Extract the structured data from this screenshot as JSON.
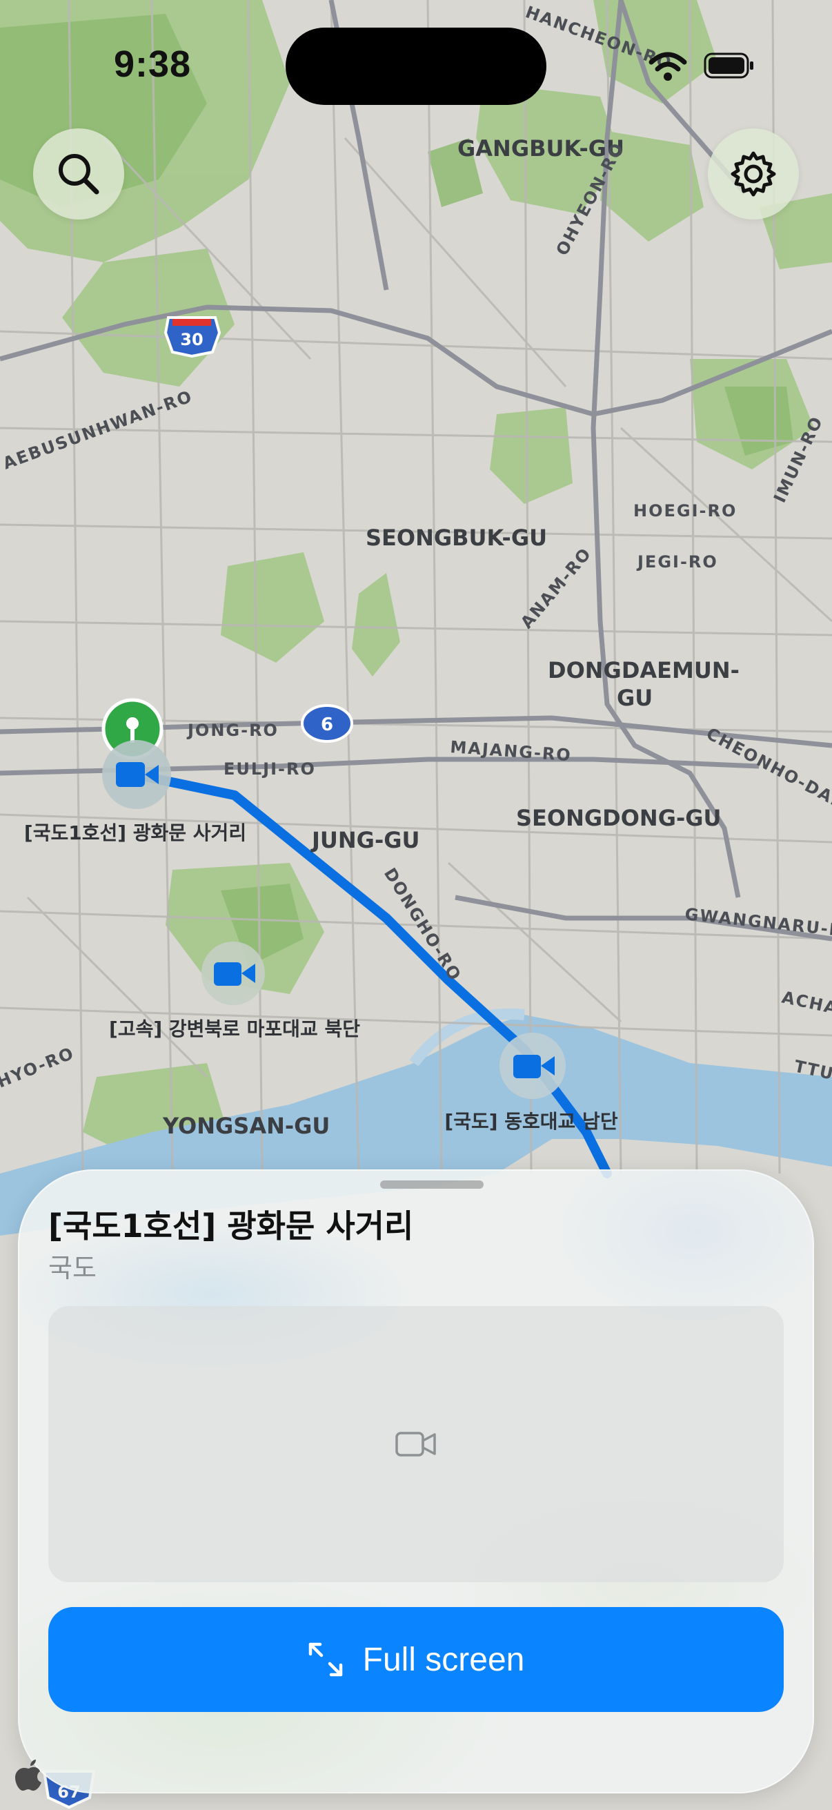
{
  "status_bar": {
    "time": "9:38"
  },
  "map": {
    "districts": [
      "GANGBUK-GU",
      "SEONGBUK-GU",
      "DONGDAEMUN-",
      "GU",
      "SEONGDONG-GU",
      "JUNG-GU",
      "YONGSAN-GU"
    ],
    "roads": [
      "HANCHEON-RO",
      "OHYEON-RO",
      "AEBUSUNHWAN-RO",
      "HOEGI-RO",
      "JEGI-RO",
      "IMUN-RO",
      "ANAM-RO",
      "JONG-RO",
      "EULJI-RO",
      "MAJANG-RO",
      "CHEONHO-DAER",
      "DONGHO-RO",
      "GWANGNARU-R",
      "ACHA",
      "TTUK",
      "HYO-RO"
    ],
    "route_shields": [
      "30",
      "6",
      "67"
    ],
    "cameras": [
      {
        "label": "[국도1호선] 광화문 사거리",
        "selected": true
      },
      {
        "label": "[고속] 강변북로 마포대교 북단",
        "selected": false
      },
      {
        "label": "[국도] 동호대교 남단",
        "selected": false
      }
    ],
    "route_color": "#0a6fe0"
  },
  "toolbar": {
    "search_icon": "magnifying-glass",
    "settings_icon": "gear"
  },
  "sheet": {
    "title": "[국도1호선] 광화문 사거리",
    "subtitle": "국도",
    "video_placeholder_icon": "video-camera",
    "full_screen_label": "Full screen",
    "full_screen_icon": "expand-arrows",
    "accent": "#0a84ff"
  }
}
